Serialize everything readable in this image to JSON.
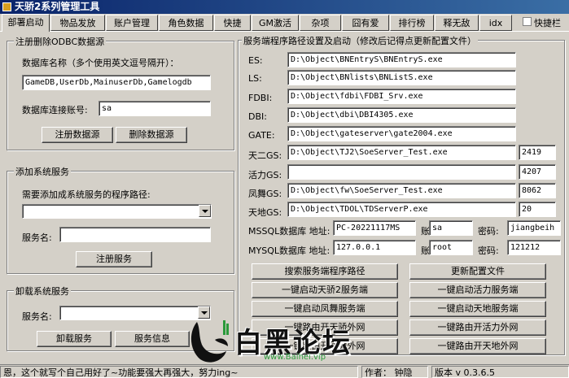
{
  "window": {
    "title": "天骄2系列管理工具"
  },
  "tabs": [
    {
      "label": "部署启动"
    },
    {
      "label": "物品发放"
    },
    {
      "label": "账户管理"
    },
    {
      "label": "角色数据"
    },
    {
      "label": "快捷"
    },
    {
      "label": "GM激活"
    },
    {
      "label": "杂项"
    },
    {
      "label": "囧有爱"
    },
    {
      "label": "排行榜"
    },
    {
      "label": "释无敌"
    },
    {
      "label": "idx"
    }
  ],
  "topbar": {
    "quick_checkbox_label": "快捷栏"
  },
  "odbc_group": {
    "title": "注册删除ODBC数据源",
    "db_name_label": "数据库名称（多个使用英文逗号隔开）：",
    "db_name_value": "GameDB,UserDb,MainuserDb,Gamelogdb",
    "account_label": "数据库连接账号:",
    "account_value": "sa",
    "register_button": "注册数据源",
    "delete_button": "删除数据源"
  },
  "add_service_group": {
    "title": "添加系统服务",
    "path_label": "需要添加成系统服务的程序路径:",
    "path_value": "",
    "service_name_label": "服务名:",
    "service_name_value": "",
    "register_button": "注册服务"
  },
  "uninstall_group": {
    "title": "卸载系统服务",
    "service_name_label": "服务名:",
    "service_name_value": "",
    "uninstall_button": "卸载服务",
    "info_button": "服务信息"
  },
  "server_group": {
    "title": "服务端程序路径设置及启动（修改后记得点更新配置文件）",
    "rows": [
      {
        "label": "ES:",
        "path": "D:\\Object\\BNEntryS\\BNEntryS.exe",
        "port": ""
      },
      {
        "label": "LS:",
        "path": "D:\\Object\\BNlists\\BNListS.exe",
        "port": ""
      },
      {
        "label": "FDBI:",
        "path": "D:\\Object\\fdbi\\FDBI_Srv.exe",
        "port": ""
      },
      {
        "label": "DBI:",
        "path": "D:\\Object\\dbi\\DBI4305.exe",
        "port": ""
      },
      {
        "label": "GATE:",
        "path": "D:\\Object\\gateserver\\gate2004.exe",
        "port": ""
      },
      {
        "label": "天二GS:",
        "path": "D:\\Object\\TJ2\\SoeServer_Test.exe",
        "port": "2419"
      },
      {
        "label": "活力GS:",
        "path": "",
        "port": "4207"
      },
      {
        "label": "凤舞GS:",
        "path": "D:\\Object\\fw\\SoeServer_Test.exe",
        "port": "8062"
      },
      {
        "label": "天地GS:",
        "path": "D:\\Object\\TDOL\\TDServerP.exe",
        "port": "20"
      }
    ],
    "mssql": {
      "label": "MSSQL数据库 地址:",
      "address": "PC-20221117MS",
      "account_label": "账号:",
      "account": "sa",
      "password_label": "密码:",
      "password": "jiangbeih"
    },
    "mysql": {
      "label": "MYSQL数据库 地址:",
      "address": "127.0.0.1",
      "account_label": "账号:",
      "account": "root",
      "password_label": "密码:",
      "password": "121212"
    },
    "buttons": [
      "搜索服务端程序路径",
      "更新配置文件",
      "一键启动天骄2服务端",
      "一键启动活力服务端",
      "一键启动凤舞服务端",
      "一键启动天地服务端",
      "一键路由开天骄外网",
      "一键路由开活力外网",
      "一键路由开凤舞外网",
      "一键路由开天地外网"
    ]
  },
  "statusbar": {
    "message": "恩，这个就写个自己用好了~功能要强大再强大，努力ing~",
    "author": "作者： 钟隐",
    "version": "版本 v 0.3.6.5"
  },
  "watermark": {
    "text": "白黑论坛",
    "url": "www.Baihei.vip"
  },
  "colors": {
    "title_gradient_start": "#0a246a",
    "title_gradient_end": "#3a6ea5",
    "face": "#d4d0c8",
    "watermark_green": "#2a9a3a"
  }
}
